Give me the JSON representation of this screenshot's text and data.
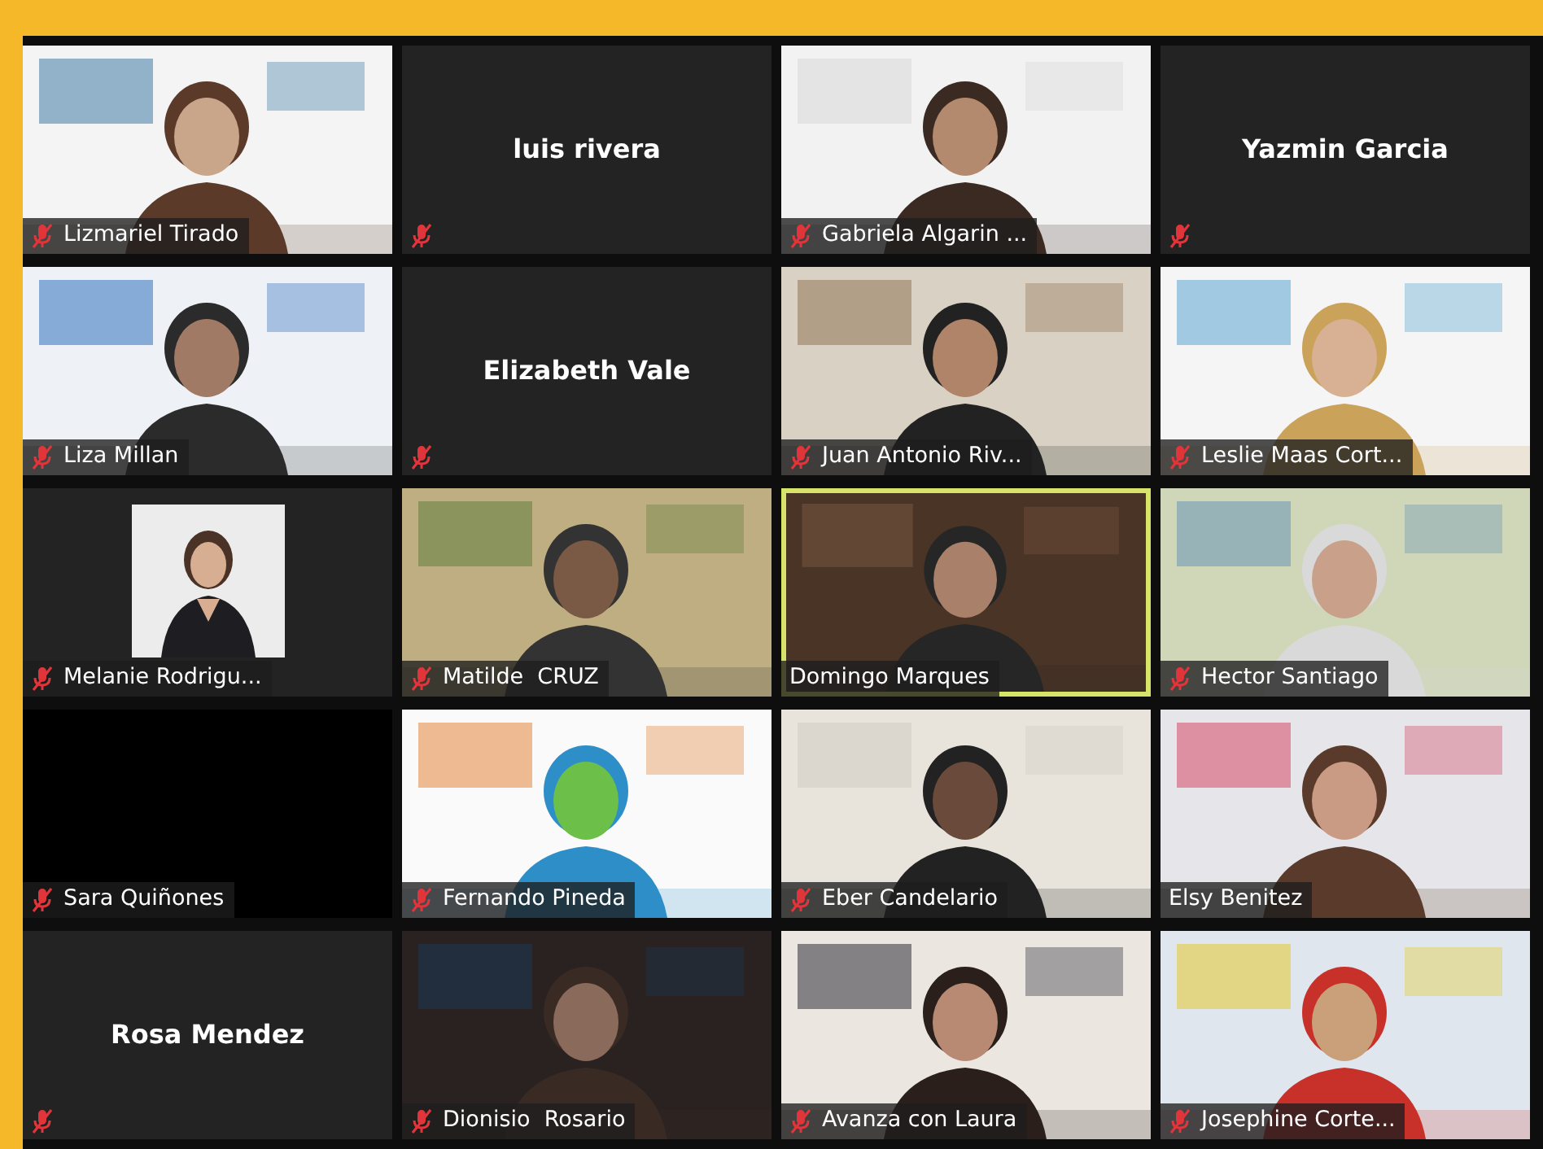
{
  "participants": [
    {
      "name": "Lizmariel Tirado",
      "kind": "video",
      "muted": true,
      "speaking": false
    },
    {
      "name": "luis rivera",
      "kind": "no_video",
      "muted": true,
      "speaking": false
    },
    {
      "name": "Gabriela Algarin ...",
      "kind": "video",
      "muted": true,
      "speaking": false
    },
    {
      "name": "Yazmin Garcia",
      "kind": "no_video",
      "muted": true,
      "speaking": false
    },
    {
      "name": "Liza Millan",
      "kind": "video",
      "muted": true,
      "speaking": false
    },
    {
      "name": "Elizabeth Vale",
      "kind": "no_video",
      "muted": true,
      "speaking": false
    },
    {
      "name": "Juan Antonio Riv...",
      "kind": "video",
      "muted": true,
      "speaking": false
    },
    {
      "name": "Leslie Maas Cort...",
      "kind": "video",
      "muted": true,
      "speaking": false
    },
    {
      "name": "Melanie Rodrigu...",
      "muted": true,
      "speaking": false
    },
    {
      "name": "Matilde  CRUZ",
      "kind": "video",
      "muted": true,
      "speaking": false
    },
    {
      "name": "Domingo Marques",
      "kind": "video",
      "muted": false,
      "speaking": true
    },
    {
      "name": "Hector Santiago",
      "kind": "video",
      "muted": true,
      "speaking": false
    },
    {
      "name": "Sara Quiñones",
      "kind": "black",
      "muted": true,
      "speaking": false
    },
    {
      "name": "Fernando Pineda",
      "kind": "video",
      "muted": true,
      "speaking": false
    },
    {
      "name": "Eber Candelario",
      "kind": "video",
      "muted": true,
      "speaking": false
    },
    {
      "name": "Elsy Benitez",
      "kind": "video",
      "muted": false,
      "speaking": false
    },
    {
      "name": "Rosa Mendez",
      "kind": "no_video",
      "muted": true,
      "speaking": false
    },
    {
      "name": "Dionisio  Rosario",
      "kind": "video",
      "muted": true,
      "speaking": false
    },
    {
      "name": "Avanza con Laura",
      "kind": "video",
      "muted": true,
      "speaking": false
    },
    {
      "name": "Josephine Corte...",
      "kind": "video",
      "muted": true,
      "speaking": false
    }
  ]
}
